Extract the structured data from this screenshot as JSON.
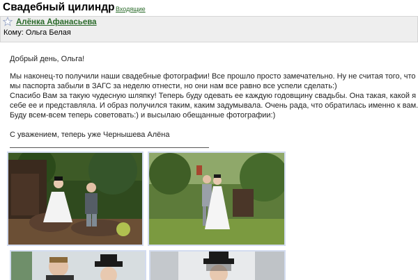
{
  "message": {
    "subject": "Свадебный цилиндр",
    "folder_link": "Входящие",
    "sender": "Алёнка Афанасьева",
    "to_line": "Кому: Ольга Белая",
    "greeting": "Добрый день, Ольга!",
    "paragraph_lines": [
      "Мы наконец-то получили наши свадебные фотографии! Все прошло просто замечательно. Ну не считая того, что",
      "мы паспорта забыли в ЗАГС за неделю отнести, но они нам все равно все успели сделать:)",
      "Спасибо Вам за такую чудесную шляпку! Теперь буду одевать ее каждую годовщину свадьбы. Она такая, какой я",
      "себе ее и представляла. И образ получился таким, каким задумывала. Очень рада, что обратилась именно к вам.",
      "Буду всем-всем теперь советовать:) и высылаю обещанные фотографии:)"
    ],
    "signature": "С уважением, теперь уже Чернышева Алёна"
  },
  "icons": {
    "star": "star-outline-icon"
  },
  "colors": {
    "link_green": "#2a6a2a",
    "header_bg": "#eeeeee",
    "photo_border": "#d3dcf0"
  }
}
